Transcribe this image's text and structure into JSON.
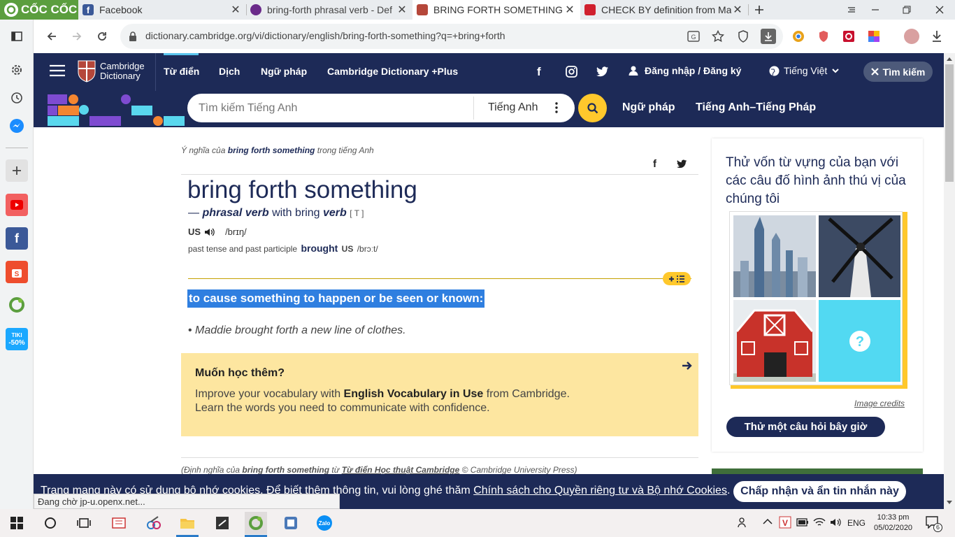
{
  "browser": {
    "brand": "CỐC CỐC",
    "tabs": [
      {
        "title": "Facebook"
      },
      {
        "title": "bring-forth phrasal verb - Def"
      },
      {
        "title": "BRING FORTH SOMETHING |"
      },
      {
        "title": "CHECK BY definition from Ma"
      }
    ],
    "url": "dictionary.cambridge.org/vi/dictionary/english/bring-forth-something?q=+bring+forth"
  },
  "site": {
    "logo_line1": "Cambridge",
    "logo_line2": "Dictionary",
    "nav": [
      "Từ điển",
      "Dịch",
      "Ngữ pháp",
      "Cambridge Dictionary +Plus"
    ],
    "login": "Đăng nhập / Đăng ký",
    "language": "Tiếng Việt",
    "search_top_label": "Tìm kiếm",
    "search_placeholder": "Tìm kiếm Tiếng Anh",
    "search_lang": "Tiếng Anh",
    "links": [
      "Ngữ pháp",
      "Tiếng Anh–Tiếng Pháp"
    ]
  },
  "entry": {
    "breadcrumb_prefix": "Ý nghĩa của",
    "breadcrumb_word": "bring forth something",
    "breadcrumb_suffix": "trong tiếng Anh",
    "headword": "bring forth something",
    "pos_dash": "—",
    "pos": "phrasal verb",
    "pos_with": "with bring",
    "pos2": "verb",
    "grammar": "[ T ]",
    "region": "US",
    "ipa": "/brɪŋ/",
    "past_label": "past tense and past participle",
    "past_word": "brought",
    "past_region": "US",
    "past_ipa": "/brɔːt/",
    "definition": "to cause something to happen or be seen or known:",
    "example": "Maddie brought forth a new line of clothes."
  },
  "learn": {
    "title": "Muốn học thêm?",
    "line1_pre": "Improve your vocabulary with",
    "line1_bold": "English Vocabulary in Use",
    "line1_post": "from Cambridge.",
    "line2": "Learn the words you need to communicate with confidence."
  },
  "footnote": {
    "pre": "(Định nghĩa của",
    "word": "bring forth something",
    "mid": "từ",
    "source": "Từ điển Học thuật Cambridge",
    "post": "© Cambridge University Press)"
  },
  "quiz": {
    "heading": "Thử vốn từ vựng của bạn với các câu đố hình ảnh thú vị của chúng tôi",
    "credits": "Image credits",
    "button": "Thử một câu hỏi bây giờ"
  },
  "cookie": {
    "text": "Trang mạng này có sử dụng bộ nhớ cookies. Để biết thêm thông tin, vui lòng ghé thăm",
    "link": "Chính sách cho Quyền riêng tư và Bộ nhớ Cookies",
    "accept": "Chấp nhận và ẩn tin nhắn này"
  },
  "status": "Đang chờ jp-u.openx.net...",
  "taskbar": {
    "lang": "ENG",
    "time": "10:33 pm",
    "date": "05/02/2020",
    "notif_count": "6"
  },
  "colors": {
    "cambridge_navy": "#1d2a57",
    "accent_yellow": "#ffc82c",
    "highlight_blue": "#2f7fe0",
    "learn_bg": "#fde6a0"
  }
}
